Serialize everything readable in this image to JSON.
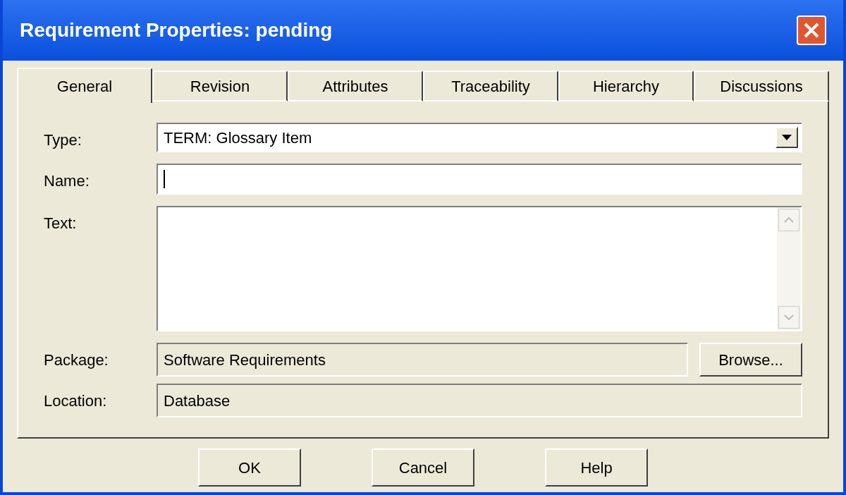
{
  "window": {
    "title": "Requirement Properties: pending"
  },
  "tabs": [
    {
      "label": "General",
      "selected": true
    },
    {
      "label": "Revision",
      "selected": false
    },
    {
      "label": "Attributes",
      "selected": false
    },
    {
      "label": "Traceability",
      "selected": false
    },
    {
      "label": "Hierarchy",
      "selected": false
    },
    {
      "label": "Discussions",
      "selected": false
    }
  ],
  "form": {
    "type": {
      "label": "Type:",
      "value": "TERM: Glossary Item"
    },
    "name": {
      "label": "Name:"
    },
    "text": {
      "label": "Text:"
    },
    "package": {
      "label": "Package:",
      "value": "Software Requirements",
      "button": "Browse..."
    },
    "location": {
      "label": "Location:",
      "value": "Database"
    }
  },
  "buttons": [
    "OK",
    "Cancel",
    "Help"
  ]
}
